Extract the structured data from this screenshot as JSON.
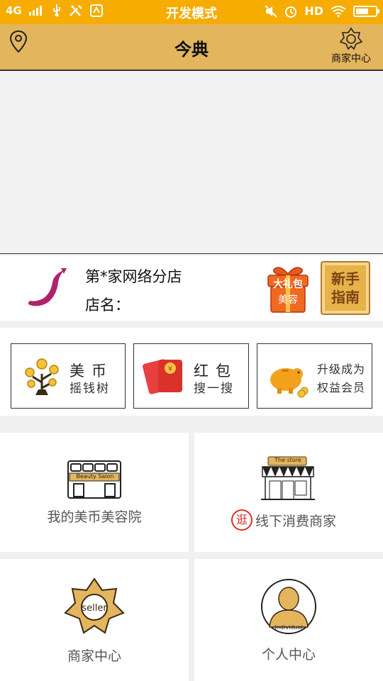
{
  "status_bar": {
    "network": "4G",
    "mode_title": "开发模式",
    "hd": "HD"
  },
  "header": {
    "title": "今典",
    "merchant_center_label": "商家中心"
  },
  "shop": {
    "name": "第*家网络分店",
    "store_label": "店名：",
    "gift_badge_line1": "大礼包",
    "gift_badge_line2": "美容",
    "guide_line1": "新手",
    "guide_line2": "指南"
  },
  "features": [
    {
      "line1": "美币",
      "line2": "摇钱树"
    },
    {
      "line1": "红包",
      "line2": "搜一搜"
    },
    {
      "line1": "升级成为",
      "line2": "权益会员"
    }
  ],
  "tiles": {
    "my_salon": {
      "label": "我的美币美容院",
      "sign_text": "Beauty Salon"
    },
    "offline_shops": {
      "label": "线下消费商家",
      "badge": "逛",
      "sign_text": "The store"
    },
    "merchant_center": {
      "label": "商家中心",
      "seal_text": "seller"
    },
    "personal_center": {
      "label": "个人中心",
      "avatar_text": "Individual"
    }
  },
  "colors": {
    "status_bar": "#f6ac00",
    "header": "#e3b55d",
    "accent_gold": "#e8b24a",
    "red": "#d9322b",
    "purple_logo": "#b0226e"
  }
}
